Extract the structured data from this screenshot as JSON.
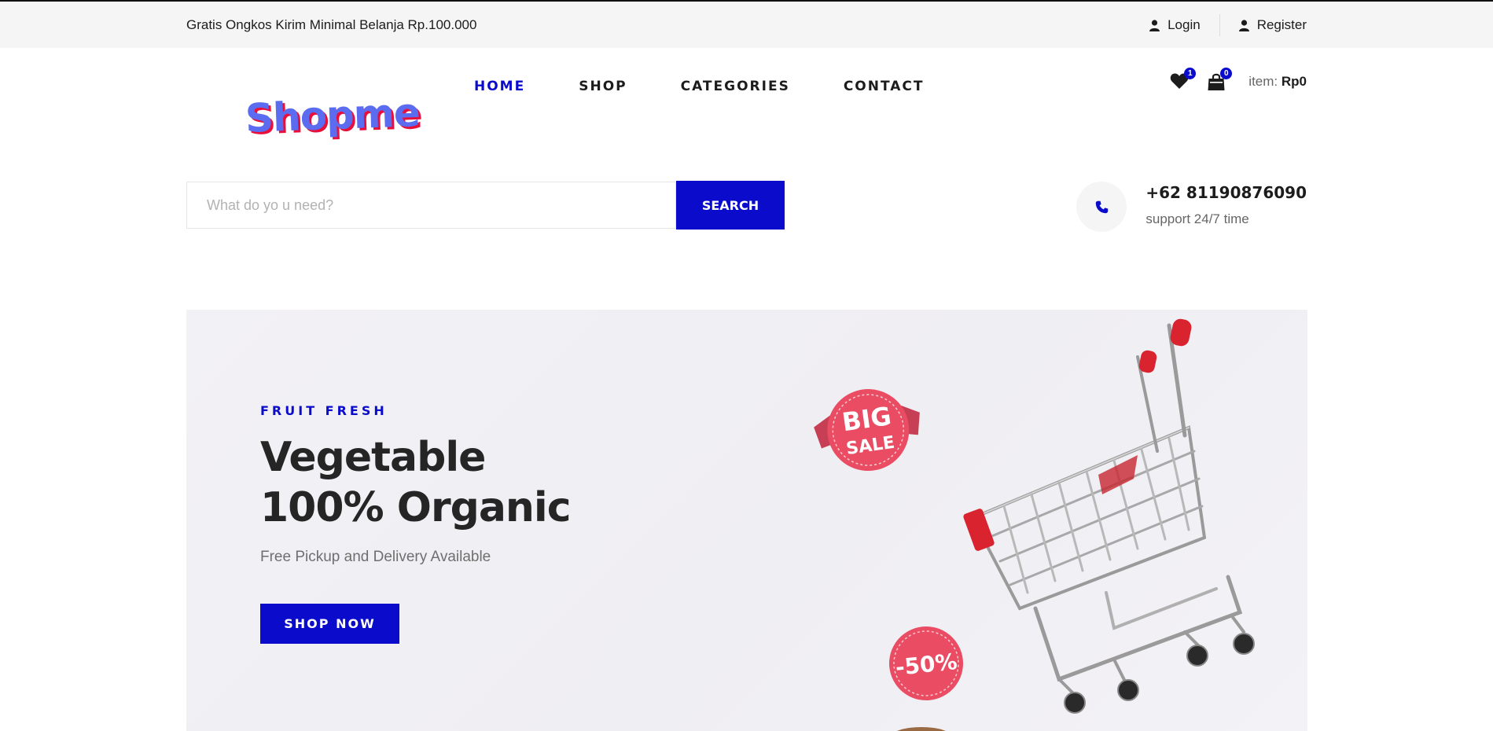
{
  "topbar": {
    "notice": "Gratis Ongkos Kirim Minimal Belanja Rp.100.000",
    "login": "Login",
    "register": "Register"
  },
  "logo": {
    "text": "Shopme"
  },
  "nav": {
    "items": [
      {
        "label": "HOME",
        "active": true
      },
      {
        "label": "SHOP"
      },
      {
        "label": "CATEGORIES"
      },
      {
        "label": "CONTACT"
      }
    ]
  },
  "cart": {
    "wishlist_count": "1",
    "cart_count": "0",
    "item_label": "item:",
    "total": "Rp0"
  },
  "search": {
    "placeholder": "What do yo u need?",
    "button": "SEARCH"
  },
  "contact": {
    "phone": "+62 81190876090",
    "support": "support 24/7 time"
  },
  "hero": {
    "eyebrow": "FRUIT FRESH",
    "title_line1": "Vegetable",
    "title_line2": "100% Organic",
    "subtitle": "Free Pickup and Delivery Available",
    "button": "SHOP NOW",
    "sticker1_line1": "BIG",
    "sticker1_line2": "SALE",
    "sticker2": "-50%"
  },
  "colors": {
    "accent": "#0b0bcc",
    "sticker": "#e94c63",
    "cart_red": "#d9232f"
  }
}
